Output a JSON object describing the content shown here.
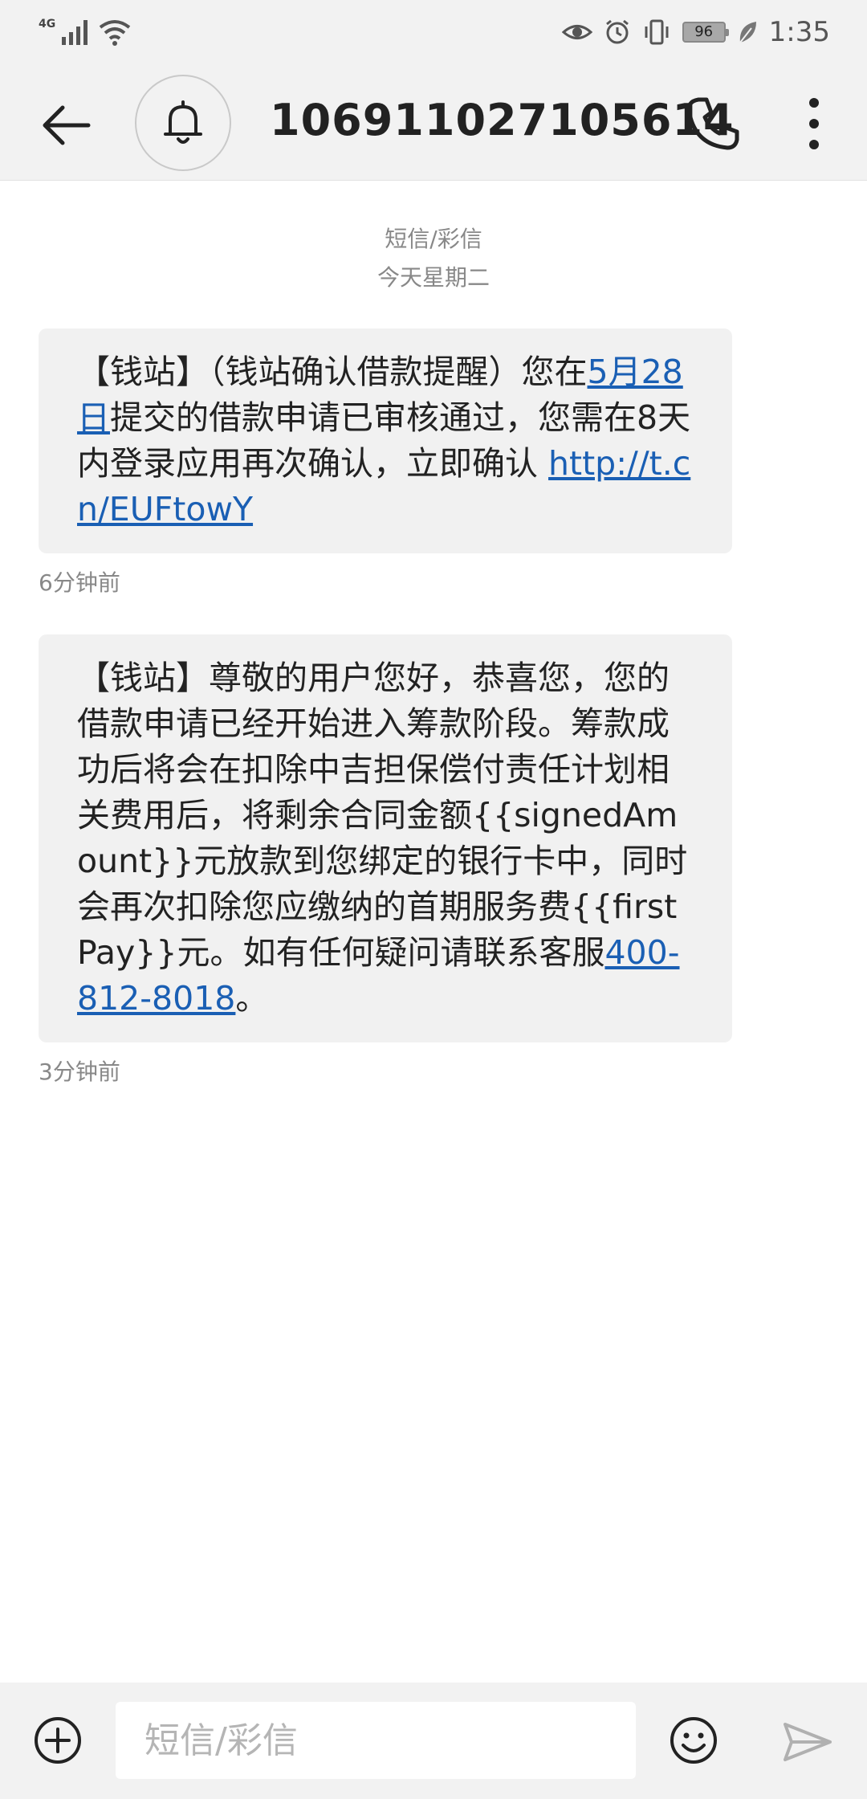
{
  "status_bar": {
    "network_label": "4G",
    "battery_level": "96",
    "time": "1:35"
  },
  "header": {
    "title": "106911027105614"
  },
  "conversation": {
    "type_label": "短信/彩信",
    "date_label": "今天星期二"
  },
  "messages": [
    {
      "prefix": "【钱站】（钱站确认借款提醒）您在",
      "link_date": "5月28日",
      "middle": "提交的借款申请已审核通过，您需在8天内登录应用再次确认，立即确认 ",
      "link_url": "http://t.cn/EUFtowY",
      "time": "6分钟前"
    },
    {
      "body": "【钱站】尊敬的用户您好，恭喜您，您的借款申请已经开始进入筹款阶段。筹款成功后将会在扣除中吉担保偿付责任计划相关费用后，将剩余合同金额{{signedAmount}}元放款到您绑定的银行卡中，同时会再次扣除您应缴纳的首期服务费{{firstPay}}元。如有任何疑问请联系客服",
      "link_phone": "400-812-8018",
      "suffix": "。",
      "time": "3分钟前"
    }
  ],
  "composer": {
    "placeholder": "短信/彩信"
  },
  "icons": {
    "back": "arrow-left-icon",
    "bell": "bell-icon",
    "call": "phone-icon",
    "more": "more-vertical-icon",
    "add": "plus-circle-icon",
    "emoji": "emoji-icon",
    "send": "send-icon"
  }
}
